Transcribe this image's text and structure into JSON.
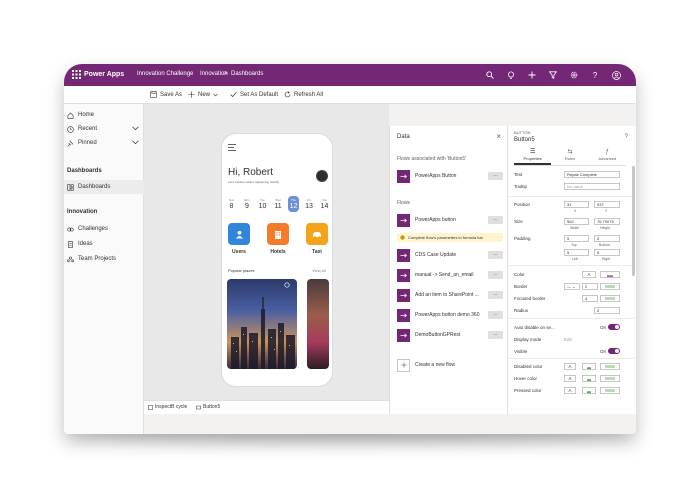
{
  "topbar": {
    "app_name": "Power Apps",
    "environment": "Innovation Challenge",
    "breadcrumb": [
      "Innovation",
      "Dashboards"
    ],
    "separator": ">"
  },
  "commandbar": {
    "save_as": "Save As",
    "new": "New",
    "set_as_default": "Set As Default",
    "refresh_all": "Refresh All"
  },
  "leftnav": {
    "items": [
      {
        "label": "Home"
      },
      {
        "label": "Recent"
      },
      {
        "label": "Pinned"
      }
    ],
    "section_dashboards": "Dashboards",
    "dashboards_item": "Dashboards",
    "section_innovation": "Innovation",
    "innovation_items": [
      {
        "label": "Challenges"
      },
      {
        "label": "Ideas"
      },
      {
        "label": "Team Projects"
      }
    ]
  },
  "phone": {
    "greeting": "Hi, Robert",
    "subtitle": "Let's explore what's happening nearby",
    "days": [
      {
        "name": "Sun",
        "num": "8"
      },
      {
        "name": "Mon",
        "num": "9"
      },
      {
        "name": "Tue",
        "num": "10"
      },
      {
        "name": "Wed",
        "num": "11"
      },
      {
        "name": "Thu",
        "num": "12"
      },
      {
        "name": "Fri",
        "num": "13"
      },
      {
        "name": "Sat",
        "num": "14"
      }
    ],
    "tiles": [
      {
        "label": "Users",
        "color": "#2f86db"
      },
      {
        "label": "Hotels",
        "color": "#f47b2a"
      },
      {
        "label": "Taxi",
        "color": "#f5a31a"
      }
    ],
    "popular_places": "Popular places",
    "view_all": "View All"
  },
  "statusbar": {
    "screen": "InspectB cycle",
    "component": "Button5"
  },
  "data_panel": {
    "title": "Data",
    "flows_associated": "Flows associated with 'Button5'",
    "assoc_flow": "PowerApps Button",
    "flows_heading": "Flows",
    "flows": [
      "PowerApps button",
      "CDS Case Update",
      "manual -> Send_an_email",
      "Add an item to SharePoint ...",
      "PowerApps button demo 360",
      "DemoButtonGPRest"
    ],
    "warning": "Complete flow's parameters in formula bar",
    "create_flow": "Create a new flow",
    "more": "..."
  },
  "props_panel": {
    "control_type": "BUTTON",
    "control_name": "Button5",
    "tabs": [
      "Properties",
      "Rules",
      "Advanced"
    ],
    "text_label": "Text",
    "text_value": "Repair Complete",
    "tooltip_label": "Tooltip",
    "tooltip_placeholder": "No value",
    "position_label": "Position",
    "position_x": "31",
    "position_y": "937",
    "x_label": "X",
    "y_label": "Y",
    "size_label": "Size",
    "size_w": "552",
    "size_h": "76.79075",
    "width_label": "Width",
    "height_label": "Height",
    "padding_label": "Padding",
    "pad_top": "5",
    "pad_bottom": "5",
    "pad_left": "5",
    "pad_right": "5",
    "top_label": "Top",
    "bottom_label": "Bottom",
    "left_label": "Left",
    "right_label": "Right",
    "color_label": "Color",
    "border_label": "Border",
    "border_width": "2",
    "focused_border_label": "Focused border",
    "focused_border_value": "4",
    "radius_label": "Radius",
    "radius_value": "0",
    "auto_disable_label": "Auto disable on se...",
    "auto_disable_state": "On",
    "display_mode_label": "Display mode",
    "display_mode_value": "Edit",
    "visible_label": "Visible",
    "visible_state": "On",
    "disabled_color_label": "Disabled color",
    "hover_color_label": "Hover color",
    "pressed_color_label": "Pressed color",
    "swatch_letter": "A",
    "accent": "#742774"
  }
}
